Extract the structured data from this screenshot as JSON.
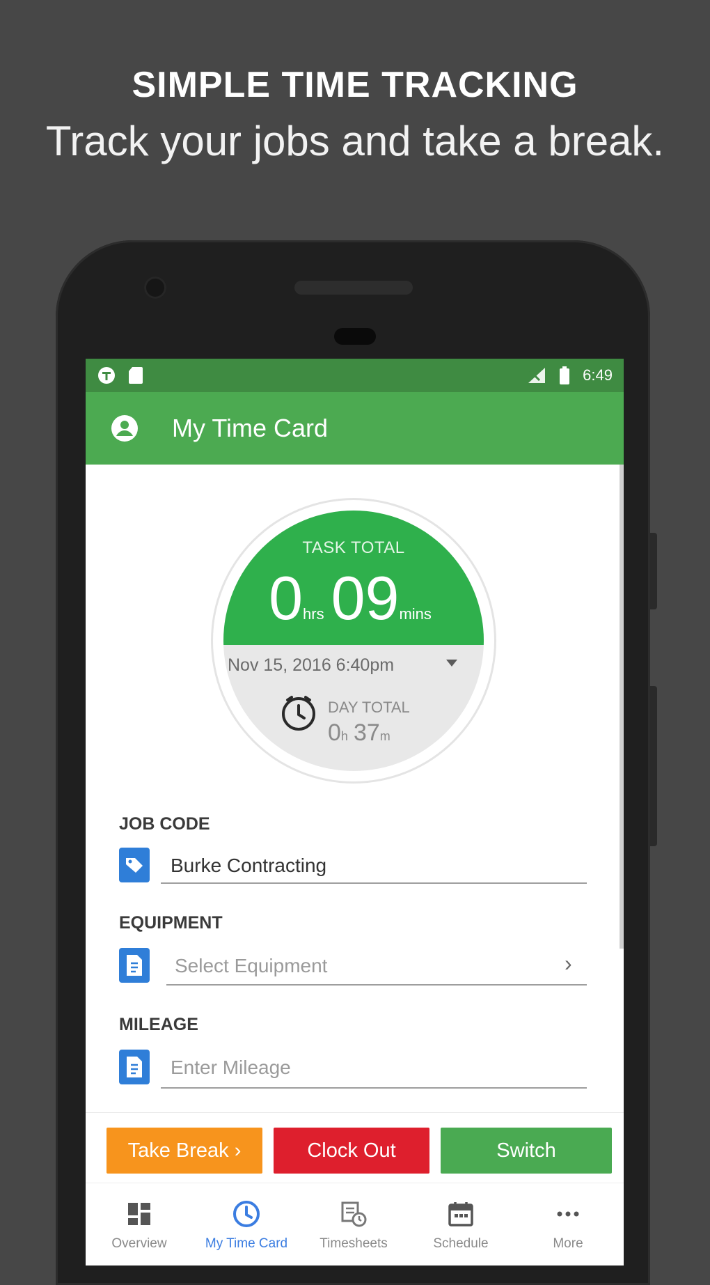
{
  "promo": {
    "title": "SIMPLE TIME TRACKING",
    "subtitle": "Track your jobs and take a break."
  },
  "status_bar": {
    "time": "6:49",
    "left_icons": [
      "t-sheets-notification-icon",
      "sd-card-icon"
    ],
    "right_icons": [
      "signal-icon",
      "battery-icon"
    ]
  },
  "app_bar": {
    "title": "My Time Card",
    "account_icon": "account-circle-icon"
  },
  "timer": {
    "task_label": "TASK TOTAL",
    "task_hours": "0",
    "task_hours_unit": "hrs",
    "task_minutes": "09",
    "task_minutes_unit": "mins",
    "start_datetime": "Nov 15, 2016 6:40pm",
    "day_label": "DAY TOTAL",
    "day_hours": "0",
    "day_hours_unit": "h",
    "day_minutes": "37",
    "day_minutes_unit": "m",
    "colors": {
      "task": "#2fb04c",
      "day": "#e8e8e8"
    }
  },
  "form": {
    "job_code": {
      "label": "JOB CODE",
      "value": "Burke Contracting"
    },
    "equipment": {
      "label": "EQUIPMENT",
      "placeholder": "Select Equipment"
    },
    "mileage": {
      "label": "MILEAGE",
      "placeholder": "Enter Mileage"
    }
  },
  "actions": {
    "take_break": "Take Break ›",
    "clock_out": "Clock Out",
    "switch": "Switch",
    "colors": {
      "take_break": "#f7941d",
      "clock_out": "#de1f2d",
      "switch": "#4aaa52"
    }
  },
  "bottom_nav": {
    "items": [
      {
        "label": "Overview",
        "icon": "dashboard-icon"
      },
      {
        "label": "My Time Card",
        "icon": "clock-icon",
        "active": true
      },
      {
        "label": "Timesheets",
        "icon": "timesheets-icon"
      },
      {
        "label": "Schedule",
        "icon": "calendar-icon"
      },
      {
        "label": "More",
        "icon": "more-icon"
      }
    ]
  },
  "colors": {
    "background": "#474747",
    "app_bar": "#4caa51",
    "status_bar": "#3f8b42",
    "accent_blue": "#3b7de1"
  }
}
